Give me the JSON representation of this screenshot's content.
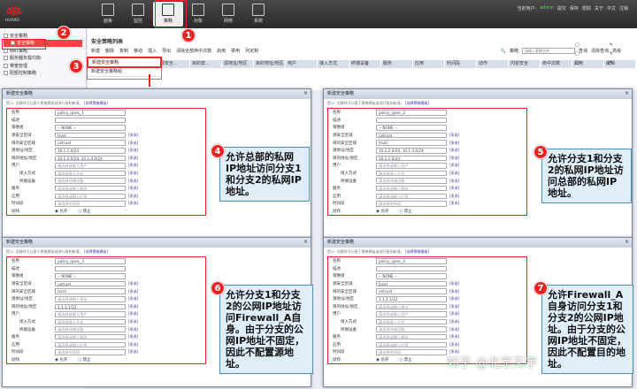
{
  "app": {
    "logo_text": "HUAWEI",
    "user_label": "当前用户:",
    "user_name": "admin",
    "save": "提交",
    "save_btn": "保存",
    "help": "帮助",
    "about": "关于",
    "cn": "中文",
    "logout": "注销"
  },
  "nav": [
    {
      "label": "面板"
    },
    {
      "label": "监控"
    },
    {
      "label": "策略"
    },
    {
      "label": "对象"
    },
    {
      "label": "网络"
    },
    {
      "label": "系统"
    }
  ],
  "tree": [
    {
      "label": "安全策略",
      "indent": 0
    },
    {
      "label": "安全策略",
      "indent": 1,
      "selected": true
    },
    {
      "label": "NAT策略",
      "indent": 0
    },
    {
      "label": "服务器负载均衡",
      "indent": 0
    },
    {
      "label": "带宽管理",
      "indent": 0
    },
    {
      "label": "配额控制策略",
      "indent": 0
    }
  ],
  "main": {
    "title": "安全策略列表",
    "toolbar": [
      "新建",
      "删除",
      "复制",
      "移动",
      "插入",
      "导出",
      "清除全部命中次数",
      "启用",
      "禁用",
      "列定制"
    ],
    "search_label": "策略",
    "search_placeholder": "请输入策略名称",
    "query": "查询",
    "clear": "清除查询",
    "advanced": "高级",
    "columns": [
      "源安全...",
      "目的安...",
      "源地址/地区",
      "目的地址/地区",
      "用户",
      "接入方式",
      "终端设备",
      "服务",
      "应用",
      "时间段",
      "动作",
      "内容安全",
      "命中次数",
      "启用",
      "编辑"
    ],
    "dropdown": [
      "新建安全策略",
      "新建安全策略组"
    ]
  },
  "forms": [
    {
      "title": "新建安全策略",
      "hint": "提示: 创建时可以基于策略模板或进行复制新建。",
      "hint_link": "[选择策略模板]",
      "fields": [
        [
          "名称",
          "policy_ipsec_1"
        ],
        [
          "描述",
          ""
        ],
        [
          "策略组",
          "-- NONE --"
        ],
        [
          "源安全区域",
          "trust"
        ],
        [
          "目的安全区域",
          "untrust"
        ],
        [
          "源地址/地区",
          "10.1.1.0/24"
        ],
        [
          "目的地址/地区",
          "10.1.2.0/24, 10.1.3.0/24"
        ],
        [
          "用户",
          "请选择或输入用户"
        ],
        [
          "接入方式",
          "请选择接入方式"
        ],
        [
          "终端设备",
          "请选择终端设备"
        ],
        [
          "服务",
          "请选择或输入服务"
        ],
        [
          "应用",
          "请选择或输入应用"
        ],
        [
          "时间段",
          "请选择时间段"
        ],
        [
          "动作",
          "允许"
        ]
      ]
    },
    {
      "title": "新建安全策略",
      "hint": "提示: 创建时可以基于策略模板或进行复制新建。",
      "hint_link": "[选择策略模板]",
      "fields": [
        [
          "名称",
          "policy_ipsec_2"
        ],
        [
          "描述",
          ""
        ],
        [
          "策略组",
          "-- NONE --"
        ],
        [
          "源安全区域",
          "untrust"
        ],
        [
          "目的安全区域",
          "trust"
        ],
        [
          "源地址/地区",
          "10.1.2.0/24, 10.1.3.0/24"
        ],
        [
          "目的地址/地区",
          "10.1.1.0/24"
        ],
        [
          "用户",
          "请选择或输入用户"
        ],
        [
          "接入方式",
          "请选择接入方式"
        ],
        [
          "终端设备",
          "请选择终端设备"
        ],
        [
          "服务",
          "请选择或输入服务"
        ],
        [
          "应用",
          "请选择或输入应用"
        ],
        [
          "时间段",
          "请选择时间段"
        ],
        [
          "动作",
          "允许"
        ]
      ]
    },
    {
      "title": "新建安全策略",
      "hint": "提示: 创建时可以基于策略模板或进行复制新建。",
      "hint_link": "[选择策略模板]",
      "fields": [
        [
          "名称",
          "policy_ipsec_3"
        ],
        [
          "描述",
          ""
        ],
        [
          "策略组",
          "-- NONE --"
        ],
        [
          "源安全区域",
          "untrust"
        ],
        [
          "目的安全区域",
          "local"
        ],
        [
          "源地址/地区",
          "请选择或输入地址"
        ],
        [
          "目的地址/地区",
          "1.1.1.1/32"
        ],
        [
          "用户",
          "请选择或输入用户"
        ],
        [
          "接入方式",
          "请选择接入方式"
        ],
        [
          "终端设备",
          "请选择终端设备"
        ],
        [
          "服务",
          "请选择或输入服务"
        ],
        [
          "应用",
          "请选择或输入应用"
        ],
        [
          "时间段",
          "请选择时间段"
        ],
        [
          "动作",
          "允许"
        ]
      ]
    },
    {
      "title": "新建安全策略",
      "hint": "提示: 创建时可以基于策略模板或进行复制新建。",
      "hint_link": "[选择策略模板]",
      "fields": [
        [
          "名称",
          "policy_ipsec_4"
        ],
        [
          "描述",
          ""
        ],
        [
          "策略组",
          "-- NONE --"
        ],
        [
          "源安全区域",
          "local"
        ],
        [
          "目的安全区域",
          "untrust"
        ],
        [
          "源地址/地区",
          "1.1.1.1/32"
        ],
        [
          "目的地址/地区",
          "请选择或输入地址"
        ],
        [
          "用户",
          "请选择或输入用户"
        ],
        [
          "接入方式",
          "请选择接入方式"
        ],
        [
          "终端设备",
          "请选择终端设备"
        ],
        [
          "服务",
          "请选择或输入服务"
        ],
        [
          "应用",
          "请选择或输入应用"
        ],
        [
          "时间段",
          "请选择时间段"
        ],
        [
          "动作",
          "允许"
        ]
      ]
    }
  ],
  "radio_allow": "允许",
  "radio_deny": "禁止",
  "multi_link": "[多选]",
  "callouts": [
    {
      "num": "4",
      "text": "允许总部的私网IP地址访问分支1和分支2的私网IP地址。"
    },
    {
      "num": "5",
      "text": "允许分支1和分支2的私网IP地址访问总部的私网IP地址。"
    },
    {
      "num": "6",
      "text": "允许分支1和分支2的公网IP地址访问Firewall_A自身。由于分支的公网IP地址不固定，因此不配置源地址。"
    },
    {
      "num": "7",
      "text": "允许Firewall_A自身访问分支1和分支2的公网IP地址。由于分支的公网IP地址不固定，因此不配置目的地址。"
    }
  ],
  "steps": [
    "1",
    "2",
    "3"
  ],
  "watermark": "知乎 @北京天宇"
}
